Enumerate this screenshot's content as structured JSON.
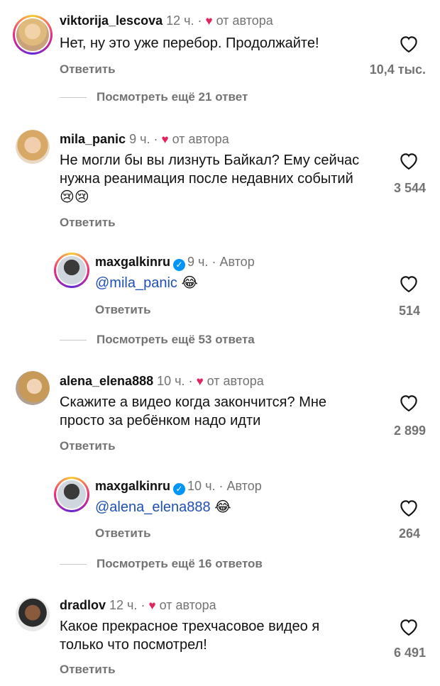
{
  "reply_label": "Ответить",
  "author_tag": "от автора",
  "author_label": "Автор",
  "dot": "·",
  "comments": [
    {
      "user": "viktorija_lescova",
      "time": "12 ч.",
      "text": "Нет, ну это уже перебор. Продолжайте!",
      "likes": "10,4 тыс."
    },
    {
      "user": "mila_panic",
      "time": "9 ч.",
      "text": "Не могли бы вы лизнуть Байкал? Ему сейчас нужна реанимация после недавних событий 😢😢",
      "likes": "3 544"
    },
    {
      "user": "maxgalkinru",
      "time": "9 ч.",
      "mention": "@mila_panic",
      "emoji": "😂",
      "likes": "514"
    },
    {
      "user": "alena_elena888",
      "time": "10 ч.",
      "text": "Скажите а видео когда закончится? Мне просто за ребёнком надо идти",
      "likes": "2 899"
    },
    {
      "user": "maxgalkinru",
      "time": "10 ч.",
      "mention": "@alena_elena888",
      "emoji": "😂",
      "likes": "264"
    },
    {
      "user": "dradlov",
      "time": "12 ч.",
      "text": "Какое прекрасное трехчасовое видео я только что посмотрел!",
      "likes": "6 491"
    }
  ],
  "view_more": [
    "Посмотреть ещё 21 ответ",
    "Посмотреть ещё 53 ответа",
    "Посмотреть ещё 16 ответов"
  ],
  "colors": {
    "heart": "#e0245e",
    "mention": "#1f50b5",
    "verified": "#0095f6",
    "muted": "#737373"
  },
  "icons": {
    "like": "heart-outline-icon",
    "author_like": "heart-filled-icon",
    "verified": "verified-badge-icon"
  }
}
